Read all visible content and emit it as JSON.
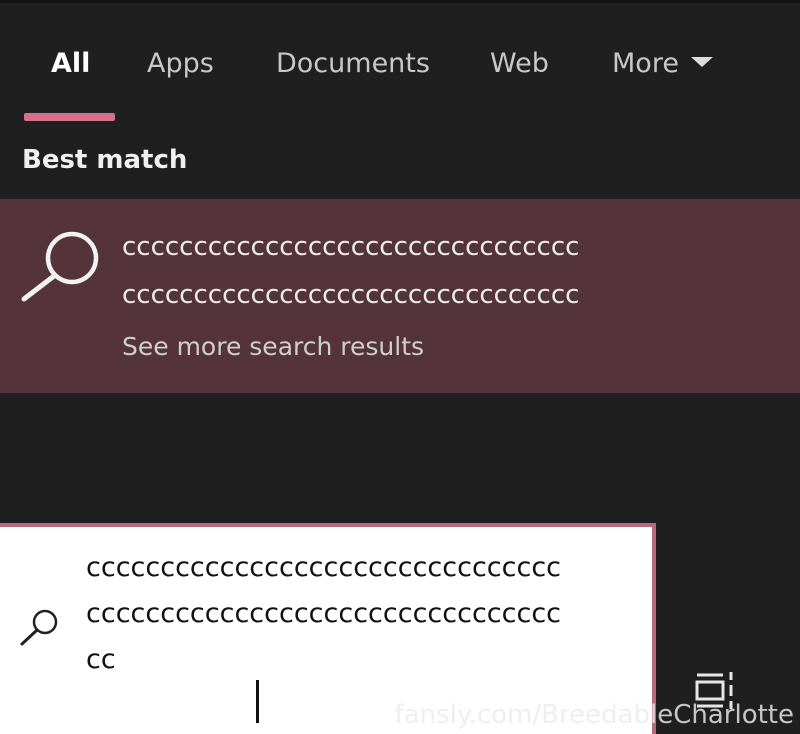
{
  "tabs": [
    {
      "label": "All",
      "active": true
    },
    {
      "label": "Apps"
    },
    {
      "label": "Documents"
    },
    {
      "label": "Web"
    },
    {
      "label": "More"
    }
  ],
  "section": {
    "title": "Best match"
  },
  "best_match": {
    "line1": "cccccccccccccccccccccccccccccccc",
    "line2": "cccccccccccccccccccccccccccccccc",
    "see_more": "See more search results"
  },
  "search": {
    "line1": "cccccccccccccccccccccccccccccccc",
    "line2": "cccccccccccccccccccccccccccccccc",
    "line3": "cc"
  },
  "taskbar": {
    "icon": "task-view-icon"
  },
  "watermark": "fansly.com/BreedableCharlotte",
  "colors": {
    "background": "#1f1f1f",
    "accent": "#d7708c",
    "best_match_bg": "#54333b",
    "search_border": "#b66a7d"
  }
}
